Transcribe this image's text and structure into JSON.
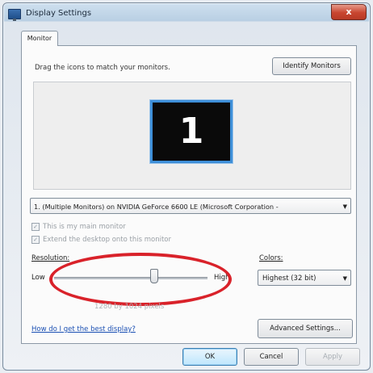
{
  "window": {
    "title": "Display Settings",
    "close_glyph": "x"
  },
  "tabs": [
    {
      "label": "Monitor"
    }
  ],
  "monitor": {
    "drag_instruction": "Drag the icons to match your monitors.",
    "identify_button": "Identify Monitors",
    "monitor_number": "1",
    "selected_monitor": "1. (Multiple Monitors) on NVIDIA GeForce 6600 LE (Microsoft Corporation -",
    "checkbox_main": {
      "label": "This is my main monitor",
      "checked": true
    },
    "checkbox_extend": {
      "label": "Extend the desktop onto this monitor",
      "checked": true
    }
  },
  "resolution": {
    "label": "Resolution:",
    "low": "Low",
    "high": "High",
    "value": "1280 by 1024 pixels",
    "slider_position": 0.65
  },
  "colors": {
    "label": "Colors:",
    "selected": "Highest (32 bit)"
  },
  "help_link": "How do I get the best display?",
  "advanced_button": "Advanced Settings...",
  "buttons": {
    "ok": "OK",
    "cancel": "Cancel",
    "apply": "Apply"
  },
  "highlight_color": "#d9222a",
  "accent_color": "#3e8fd8"
}
